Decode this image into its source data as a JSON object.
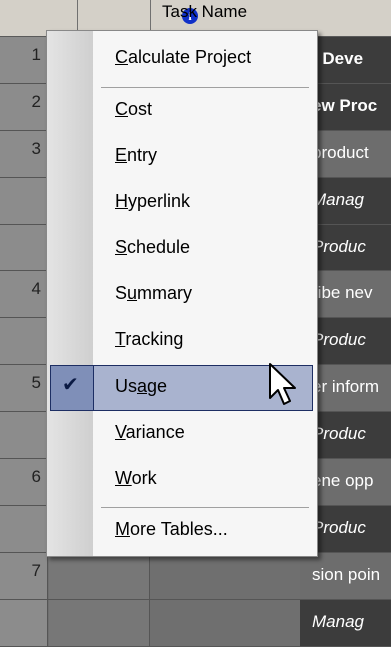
{
  "grid": {
    "header": {
      "info_icon_glyph": "i",
      "task_name_label": "Task Name"
    },
    "rows": [
      {
        "id": "1",
        "task": "t Deve",
        "style": "bold dark"
      },
      {
        "id": "2",
        "task": "ew Proc",
        "style": "bold dark"
      },
      {
        "id": "3",
        "task": "product",
        "style": "mid"
      },
      {
        "id": "",
        "task": "Manag",
        "style": "ital dark"
      },
      {
        "id": "",
        "task": "Produc",
        "style": "ital dark"
      },
      {
        "id": "4",
        "task": "ribe nev",
        "style": "mid"
      },
      {
        "id": "",
        "task": "Produc",
        "style": "ital dark"
      },
      {
        "id": "5",
        "task": "er inform",
        "style": "mid"
      },
      {
        "id": "",
        "task": "Produc",
        "style": "ital dark"
      },
      {
        "id": "6",
        "task": "ene opp",
        "style": "mid"
      },
      {
        "id": "",
        "task": "Produc",
        "style": "ital dark"
      },
      {
        "id": "7",
        "task": "sion poin",
        "style": "mid"
      },
      {
        "id": "",
        "task": "Manag",
        "style": "ital dark"
      }
    ]
  },
  "menu": {
    "items": [
      {
        "label_pre": "",
        "accel": "C",
        "label_post": "alculate Project"
      },
      {
        "label_pre": "",
        "accel": "C",
        "label_post": "ost"
      },
      {
        "label_pre": "",
        "accel": "E",
        "label_post": "ntry"
      },
      {
        "label_pre": "",
        "accel": "H",
        "label_post": "yperlink"
      },
      {
        "label_pre": "",
        "accel": "S",
        "label_post": "chedule"
      },
      {
        "label_pre": "S",
        "accel": "u",
        "label_post": "mmary"
      },
      {
        "label_pre": "",
        "accel": "T",
        "label_post": "racking"
      },
      {
        "label_pre": "Us",
        "accel": "a",
        "label_post": "ge"
      },
      {
        "label_pre": "",
        "accel": "V",
        "label_post": "ariance"
      },
      {
        "label_pre": "",
        "accel": "W",
        "label_post": "ork"
      },
      {
        "label_pre": "",
        "accel": "M",
        "label_post": "ore Tables..."
      }
    ],
    "checked_item": "Usage",
    "check_glyph": "✔"
  }
}
